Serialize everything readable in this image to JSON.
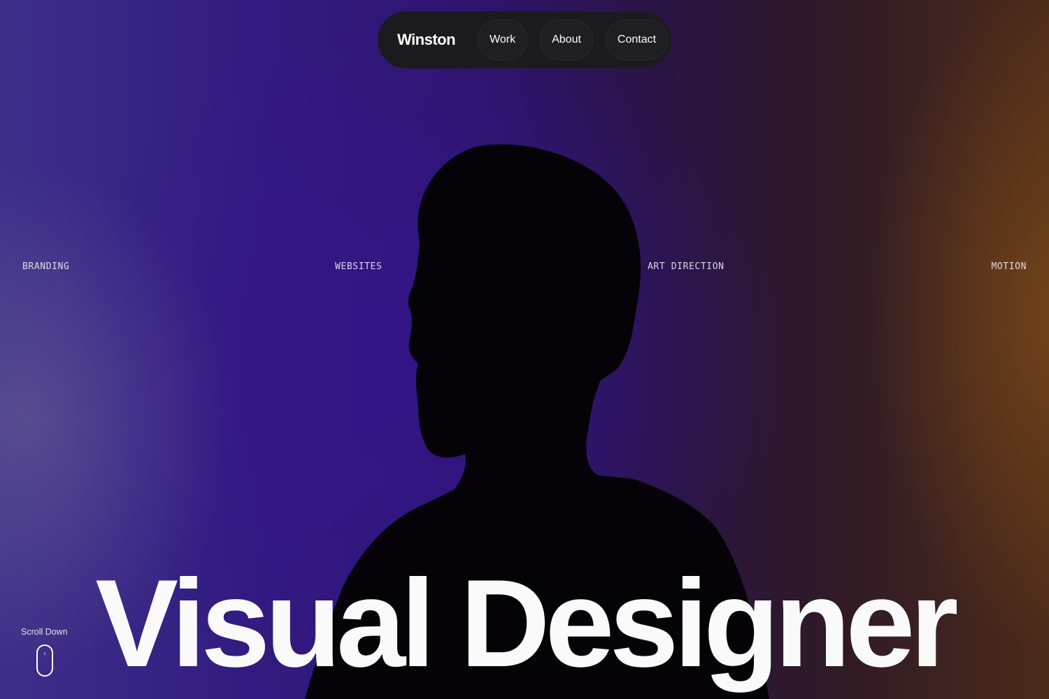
{
  "nav": {
    "brand": "Winston",
    "links": [
      {
        "label": "Work"
      },
      {
        "label": "About"
      },
      {
        "label": "Contact"
      }
    ]
  },
  "services": [
    "BRANDING",
    "WEBSITES",
    "ART DIRECTION",
    "MOTION"
  ],
  "hero": {
    "headline": "Visual Designer"
  },
  "scroll": {
    "label": "Scroll Down",
    "icon": "mouse-icon"
  },
  "colors": {
    "background_left": "#3d2f88",
    "background_center": "#2e1470",
    "background_right": "#4a2b1a",
    "nav_background": "#1b1b1f",
    "text": "#ffffff"
  }
}
